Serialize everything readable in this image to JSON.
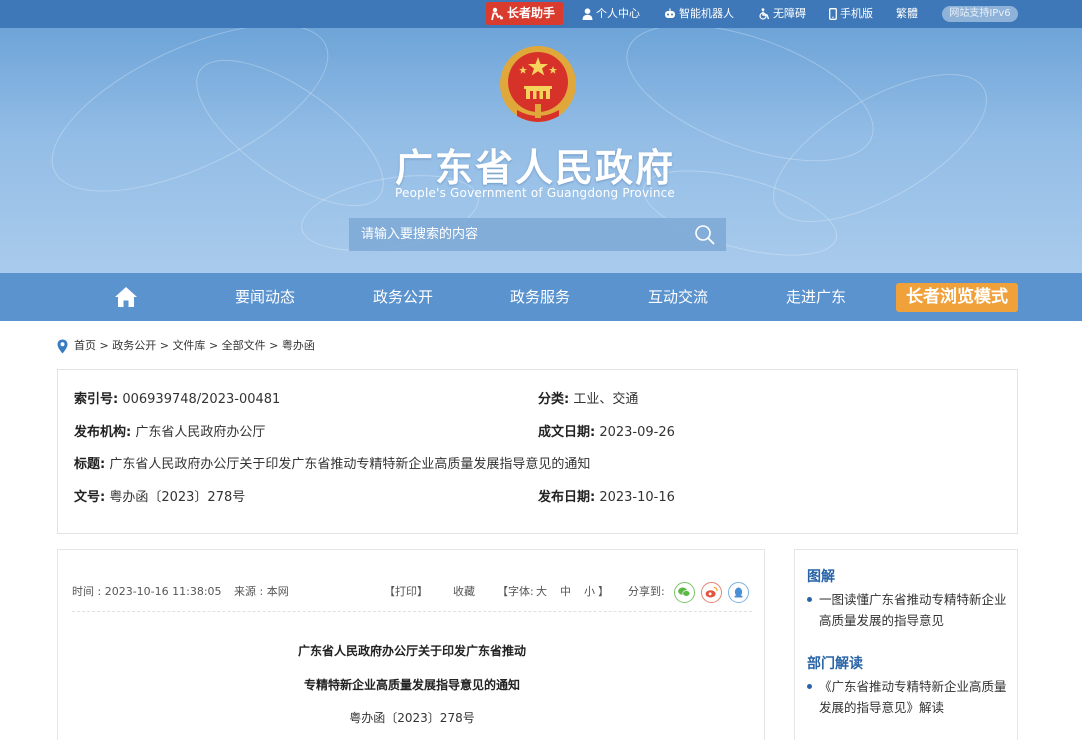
{
  "topbar": {
    "elder_assistant": "长者助手",
    "personal_center": "个人中心",
    "robot": "智能机器人",
    "accessibility": "无障碍",
    "mobile": "手机版",
    "traditional": "繁體",
    "ipv6": "网站支持IPv6"
  },
  "header": {
    "title": "广东省人民政府",
    "subtitle": "People's Government of Guangdong Province",
    "search_placeholder": "请输入要搜索的内容"
  },
  "nav": {
    "items": [
      "要闻动态",
      "政务公开",
      "政务服务",
      "互动交流",
      "走进广东"
    ],
    "elder_mode": "长者浏览模式"
  },
  "breadcrumb": {
    "items": [
      "首页",
      "政务公开",
      "文件库",
      "全部文件",
      "粤办函"
    ],
    "separator": ">"
  },
  "meta": {
    "index_label": "索引号:",
    "index_value": "006939748/2023-00481",
    "category_label": "分类:",
    "category_value": "工业、交通",
    "issuer_label": "发布机构:",
    "issuer_value": "广东省人民政府办公厅",
    "written_date_label": "成文日期:",
    "written_date_value": "2023-09-26",
    "title_label": "标题:",
    "title_value": "广东省人民政府办公厅关于印发广东省推动专精特新企业高质量发展指导意见的通知",
    "doc_no_label": "文号:",
    "doc_no_value": "粤办函〔2023〕278号",
    "publish_date_label": "发布日期:",
    "publish_date_value": "2023-10-16"
  },
  "article": {
    "time": "时间 : 2023-10-16 11:38:05",
    "source": "来源 : 本网",
    "print": "【打印】",
    "favorite": "收藏",
    "font_label": "【字体:",
    "font_large": "大",
    "font_medium": "中",
    "font_small": "小",
    "font_close": "】",
    "share_label": "分享到:",
    "title_line1": "广东省人民政府办公厅关于印发广东省推动",
    "title_line2": "专精特新企业高质量发展指导意见的通知",
    "doc_no": "粤办函〔2023〕278号"
  },
  "sidebar": {
    "section1_title": "图解",
    "section1_item": "一图读懂广东省推动专精特新企业高质量发展的指导意见",
    "section2_title": "部门解读",
    "section2_item": "《广东省推动专精特新企业高质量发展的指导意见》解读"
  },
  "colors": {
    "topbar": "#3f78b8",
    "nav": "#5b93cf",
    "elder_red": "#d93b2e",
    "elder_orange": "#f0a13a",
    "link_blue": "#2a64a8"
  }
}
